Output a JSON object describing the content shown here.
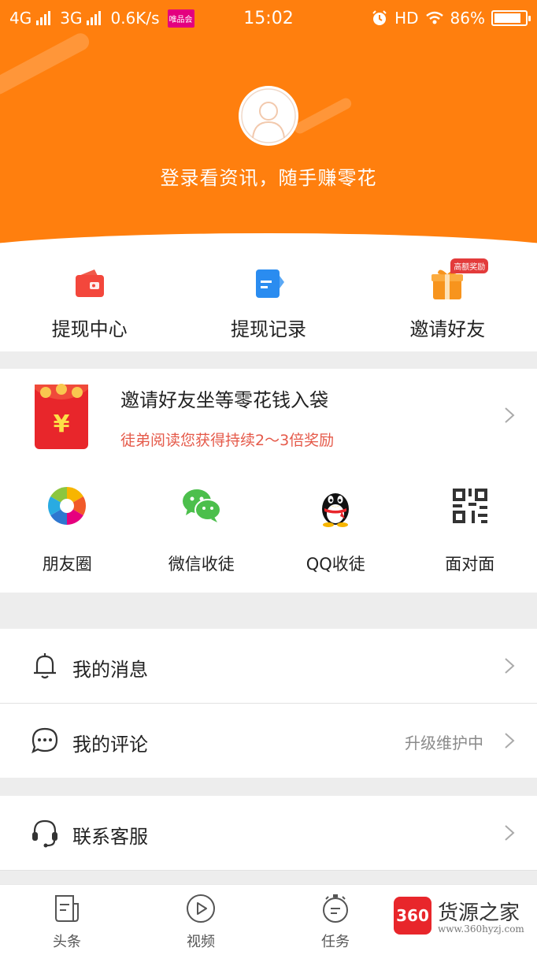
{
  "status_bar": {
    "network1": "4G",
    "network2": "3G",
    "speed": "0.6K/s",
    "app_badge": "唯品会",
    "time": "15:02",
    "hd": "HD",
    "battery": "86%",
    "battery_level": 0.86
  },
  "header": {
    "login_prompt": "登录看资讯，随手赚零花",
    "bg_color": "#ff7f0e"
  },
  "quick_actions": [
    {
      "label": "提现中心",
      "icon": "wallet-icon"
    },
    {
      "label": "提现记录",
      "icon": "record-icon"
    },
    {
      "label": "邀请好友",
      "icon": "gift-icon",
      "tag": "高额奖励"
    }
  ],
  "invite": {
    "title": "邀请好友坐等零花钱入袋",
    "subtitle": "徒弟阅读您获得持续2～3倍奖励",
    "envelope_symbol": "¥",
    "share": [
      {
        "label": "朋友圈",
        "icon": "moments-icon"
      },
      {
        "label": "微信收徒",
        "icon": "wechat-icon"
      },
      {
        "label": "QQ收徒",
        "icon": "qq-icon"
      },
      {
        "label": "面对面",
        "icon": "qrcode-icon"
      }
    ]
  },
  "menu": [
    {
      "label": "我的消息",
      "icon": "bell-icon",
      "value": ""
    },
    {
      "label": "我的评论",
      "icon": "comment-icon",
      "value": "升级维护中"
    },
    {
      "label": "联系客服",
      "icon": "headset-icon",
      "value": ""
    }
  ],
  "bottom_nav": [
    {
      "label": "头条",
      "icon": "news-icon"
    },
    {
      "label": "视频",
      "icon": "video-icon"
    },
    {
      "label": "任务",
      "icon": "task-icon"
    }
  ],
  "watermark": {
    "logo": "360",
    "title": "货源之家",
    "url": "www.360hyzj.com"
  }
}
